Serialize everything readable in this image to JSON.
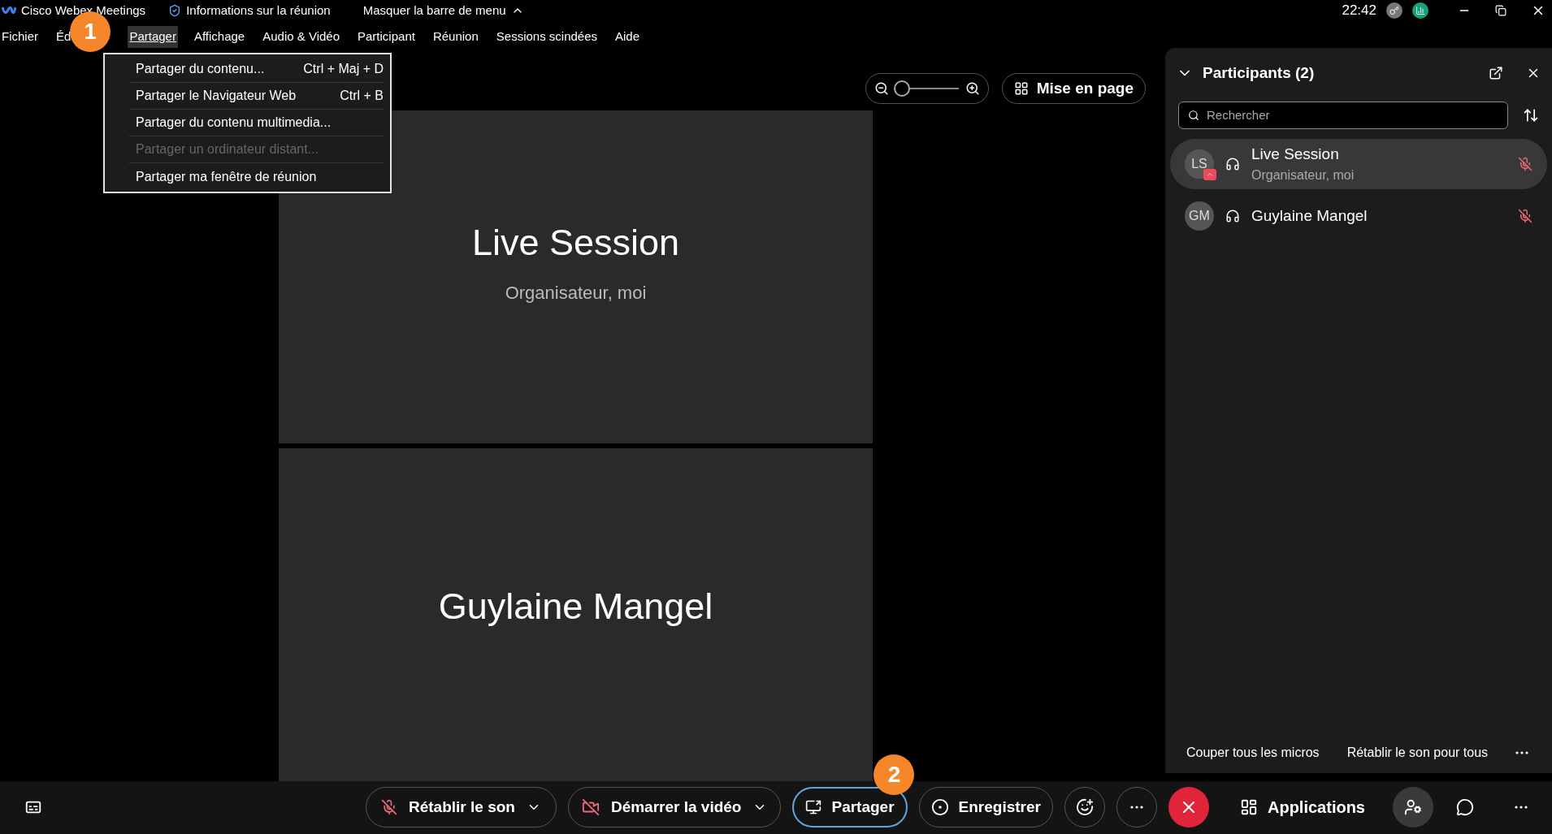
{
  "title_bar": {
    "app_name": "Cisco Webex Meetings",
    "meeting_info": "Informations sur la réunion",
    "hide_menu": "Masquer la barre de menu",
    "time": "22:42"
  },
  "menu_bar": [
    {
      "label": "Fichier",
      "selected": false
    },
    {
      "label": "Éd",
      "selected": false
    },
    {
      "label": "Partager",
      "selected": true
    },
    {
      "label": "Affichage",
      "selected": false
    },
    {
      "label": "Audio & Vidéo",
      "selected": false
    },
    {
      "label": "Participant",
      "selected": false
    },
    {
      "label": "Réunion",
      "selected": false
    },
    {
      "label": "Sessions scindées",
      "selected": false
    },
    {
      "label": "Aide",
      "selected": false
    }
  ],
  "share_menu": [
    {
      "label": "Partager du contenu...",
      "shortcut": "Ctrl + Maj + D",
      "disabled": false
    },
    {
      "label": "Partager le Navigateur Web",
      "shortcut": "Ctrl + B",
      "disabled": false
    },
    {
      "label": "Partager du contenu multimedia...",
      "disabled": false
    },
    {
      "label": "Partager un ordinateur distant...",
      "disabled": true
    },
    {
      "label": "Partager ma fenêtre de réunion",
      "disabled": false
    }
  ],
  "callouts": [
    "1",
    "2"
  ],
  "view_controls": {
    "zoom": {
      "level": 0
    },
    "layout_button": "Mise en page"
  },
  "video_tiles": [
    {
      "name": "Live Session",
      "role": "Organisateur, moi"
    },
    {
      "name": "Guylaine Mangel"
    }
  ],
  "participants_panel": {
    "title": "Participants (2)",
    "search": {
      "placeholder": "Rechercher"
    },
    "participants": [
      {
        "initials": "LS",
        "name": "Live Session",
        "role": "Organisateur, moi",
        "selected": true,
        "sharing": true,
        "muted": true
      },
      {
        "initials": "GM",
        "name": "Guylaine Mangel",
        "selected": false,
        "sharing": false,
        "muted": true
      }
    ],
    "footer_buttons": [
      "Couper tous les micros",
      "Rétablir le son pour tous"
    ]
  },
  "toolbar": {
    "unmute": "Rétablir le son",
    "start_video": "Démarrer la vidéo",
    "share": "Partager",
    "record": "Enregistrer",
    "apps": "Applications"
  }
}
